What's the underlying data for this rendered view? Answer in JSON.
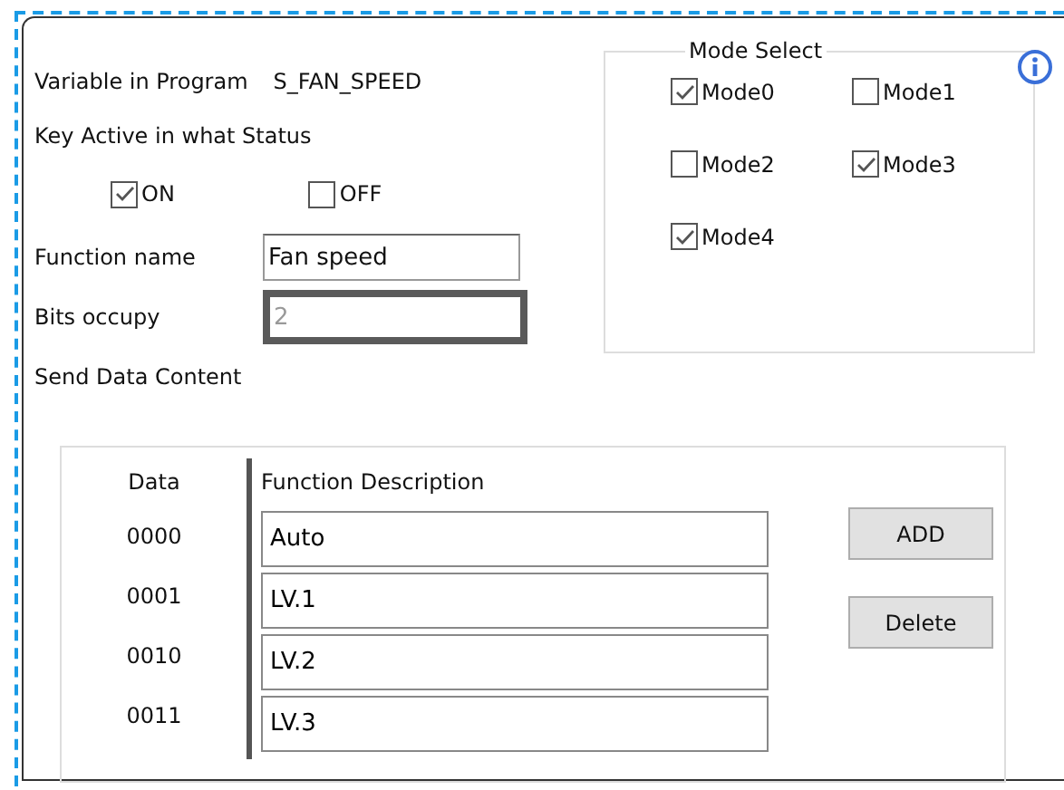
{
  "variable": {
    "label": "Variable in Program",
    "value": "S_FAN_SPEED"
  },
  "key_active": {
    "label": "Key Active in what Status",
    "options": [
      {
        "label": "ON",
        "checked": true
      },
      {
        "label": "OFF",
        "checked": false
      }
    ]
  },
  "function_name": {
    "label": "Function name",
    "value": "Fan speed"
  },
  "bits_occupy": {
    "label": "Bits occupy",
    "value": "2",
    "disabled": true
  },
  "send_data_label": "Send Data Content",
  "mode_select": {
    "title": "Mode Select",
    "modes": [
      {
        "label": "Mode0",
        "checked": true
      },
      {
        "label": "Mode1",
        "checked": false
      },
      {
        "label": "Mode2",
        "checked": false
      },
      {
        "label": "Mode3",
        "checked": true
      },
      {
        "label": "Mode4",
        "checked": true
      }
    ]
  },
  "table": {
    "columns": [
      "Data",
      "Function Description"
    ],
    "rows": [
      {
        "data": "0000",
        "description": "Auto"
      },
      {
        "data": "0001",
        "description": "LV.1"
      },
      {
        "data": "0010",
        "description": "LV.2"
      },
      {
        "data": "0011",
        "description": "LV.3"
      }
    ]
  },
  "buttons": [
    "ADD",
    "Delete"
  ]
}
